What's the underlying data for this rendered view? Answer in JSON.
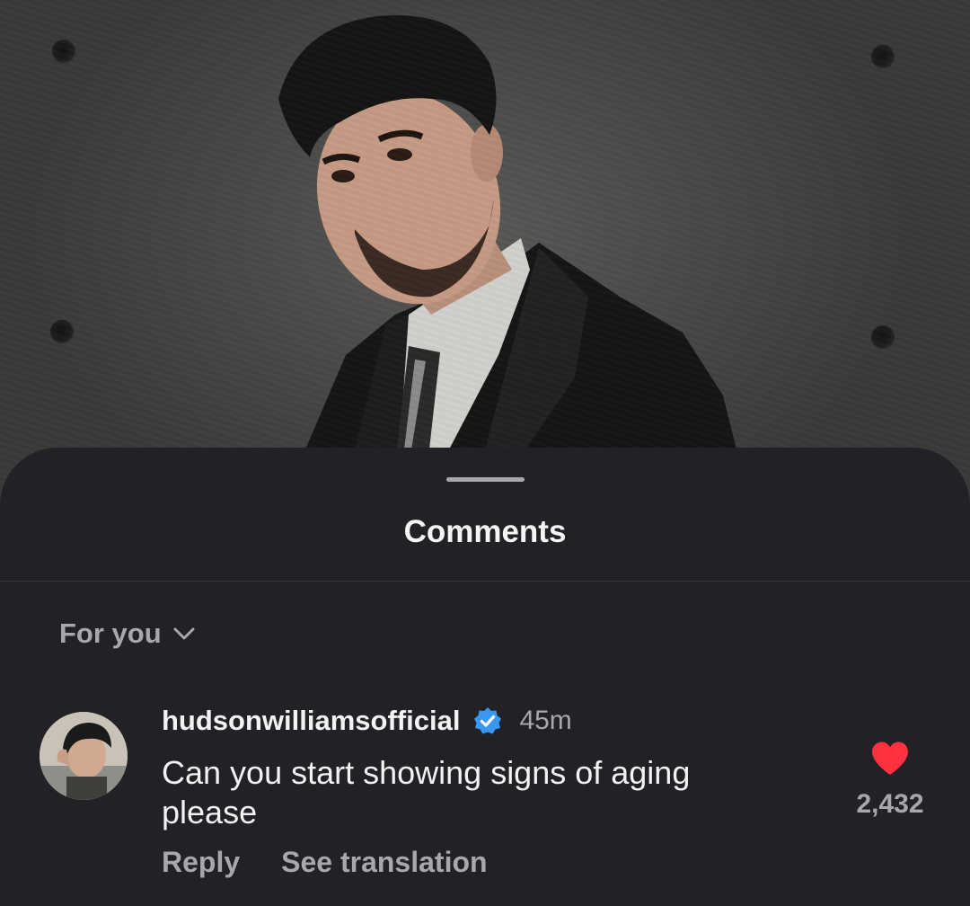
{
  "post": {
    "image_alt_icon": "post-photo"
  },
  "comments_sheet": {
    "title": "Comments",
    "sort_label": "For you"
  },
  "comment": {
    "username": "hudsonwilliamsofficial",
    "verified": true,
    "timestamp": "45m",
    "text": "Can you start showing signs of aging please",
    "reply_label": "Reply",
    "translate_label": "See translation",
    "like_count": "2,432",
    "liked": true
  },
  "colors": {
    "sheet_bg": "#222226",
    "verified_blue": "#3897f0",
    "like_red": "#ff3040",
    "secondary_text": "#a8a8ac"
  }
}
